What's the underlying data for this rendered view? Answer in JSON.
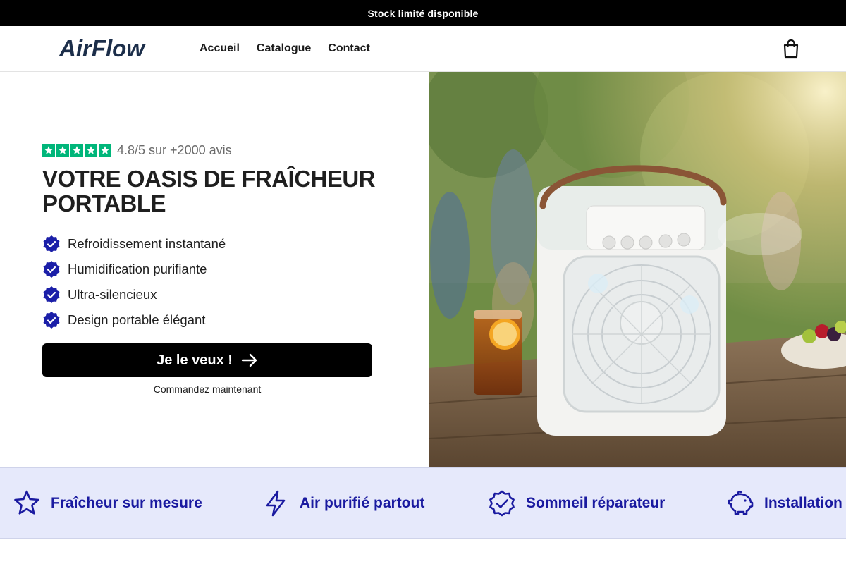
{
  "announcement": "Stock limité disponible",
  "brand": {
    "logo_text": "AirFlow"
  },
  "nav": [
    {
      "label": "Accueil",
      "active": true
    },
    {
      "label": "Catalogue",
      "active": false
    },
    {
      "label": "Contact",
      "active": false
    }
  ],
  "hero": {
    "rating": {
      "score_text": "4.8/5 sur +2000 avis",
      "stars": 5,
      "star_color": "#00b67a"
    },
    "headline": "VOTRE OASIS DE FRAÎCHEUR PORTABLE",
    "features": [
      "Refroidissement instantané",
      "Humidification purifiante",
      "Ultra-silencieux",
      "Design portable élégant"
    ],
    "cta_label": "Je le veux !",
    "cta_sub": "Commandez maintenant"
  },
  "benefits": [
    {
      "icon": "star-icon",
      "label": "Fraîcheur sur mesure"
    },
    {
      "icon": "lightning-icon",
      "label": "Air purifié partout"
    },
    {
      "icon": "check-badge-icon",
      "label": "Sommeil réparateur"
    },
    {
      "icon": "piggy-bank-icon",
      "label": "Installation f"
    }
  ],
  "colors": {
    "accent_blue": "#1a1aa0",
    "badge_blue": "#1b1fa8",
    "benefit_bg": "#e6e9fb",
    "announce_bg": "#000000"
  }
}
